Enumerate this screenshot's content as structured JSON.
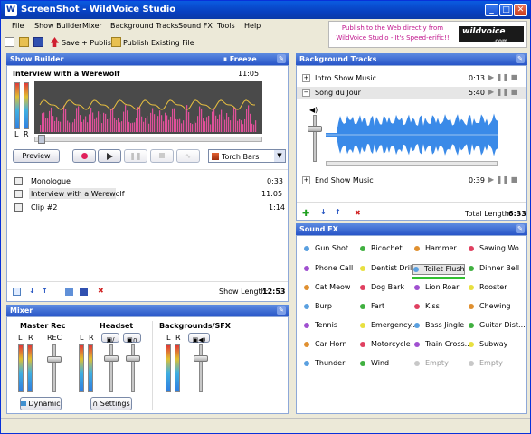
{
  "window": {
    "title": "ScreenShot - WildVoice Studio"
  },
  "menu": [
    "File",
    "Show Builder",
    "Mixer",
    "Background Tracks",
    "Sound FX",
    "Tools",
    "Help"
  ],
  "toolbar": {
    "save_publish": "Save + Publish",
    "publish_existing": "Publish Existing File"
  },
  "banner": {
    "line1": "Publish to the Web directly from",
    "line2": "WildVoice Studio - It's Speed-erific!!",
    "logo": "wildvoice",
    "logo_sub": ".com"
  },
  "show_builder": {
    "header": "Show Builder",
    "freeze": "Freeze",
    "current_title": "Interview with a Werewolf",
    "current_time": "11:05",
    "vu_l": "L",
    "vu_r": "R",
    "preview": "Preview",
    "effect": "Torch Bars",
    "items": [
      {
        "name": "Monologue",
        "time": "0:33"
      },
      {
        "name": "Interview with a Werewolf",
        "time": "11:05"
      },
      {
        "name": "Clip #2",
        "time": "1:14"
      }
    ],
    "length_label": "Show Length:",
    "length_value": "12:53"
  },
  "background_tracks": {
    "header": "Background Tracks",
    "tracks": [
      {
        "expander": "+",
        "name": "Intro Show Music",
        "time": "0:13"
      },
      {
        "expander": "−",
        "name": "Song du Jour",
        "time": "5:40"
      },
      {
        "expander": "+",
        "name": "End Show Music",
        "time": "0:39"
      }
    ],
    "total_label": "Total Length:",
    "total_value": "6:33"
  },
  "mixer": {
    "header": "Mixer",
    "master": "Master Rec",
    "headset": "Headset",
    "backgrounds": "Backgrounds/SFX",
    "rec": "REC",
    "l": "L",
    "r": "R",
    "dynamic": "Dynamic",
    "settings": "Settings"
  },
  "sound_fx": {
    "header": "Sound FX",
    "items": [
      {
        "label": "Gun Shot",
        "color": "#5aa0e0"
      },
      {
        "label": "Ricochet",
        "color": "#40b040"
      },
      {
        "label": "Hammer",
        "color": "#e09030"
      },
      {
        "label": "Sawing Wo...",
        "color": "#e04060"
      },
      {
        "label": "Phone Call",
        "color": "#a050d0"
      },
      {
        "label": "Dentist Drill",
        "color": "#e8e040"
      },
      {
        "label": "Toilet Flush",
        "color": "#5aa0e0"
      },
      {
        "label": "Dinner Bell",
        "color": "#40b040"
      },
      {
        "label": "Cat Meow",
        "color": "#e09030"
      },
      {
        "label": "Dog Bark",
        "color": "#e04060"
      },
      {
        "label": "Lion Roar",
        "color": "#a050d0"
      },
      {
        "label": "Rooster",
        "color": "#e8e040"
      },
      {
        "label": "Burp",
        "color": "#5aa0e0"
      },
      {
        "label": "Fart",
        "color": "#40b040"
      },
      {
        "label": "Kiss",
        "color": "#e04060"
      },
      {
        "label": "Chewing",
        "color": "#e09030"
      },
      {
        "label": "Tennis",
        "color": "#a050d0"
      },
      {
        "label": "Emergency...",
        "color": "#e8e040"
      },
      {
        "label": "Bass Jingle",
        "color": "#5aa0e0"
      },
      {
        "label": "Guitar Dist...",
        "color": "#40b040"
      },
      {
        "label": "Car Horn",
        "color": "#e09030"
      },
      {
        "label": "Motorcycle",
        "color": "#e04060"
      },
      {
        "label": "Train Cross...",
        "color": "#a050d0"
      },
      {
        "label": "Subway",
        "color": "#e8e040"
      },
      {
        "label": "Thunder",
        "color": "#5aa0e0"
      },
      {
        "label": "Wind",
        "color": "#40b040"
      },
      {
        "label": "Empty",
        "color": "#c8c8c8"
      },
      {
        "label": "Empty",
        "color": "#c8c8c8"
      }
    ]
  },
  "window_buttons": {
    "minimize": "_",
    "maximize": "□",
    "close": "✕"
  },
  "colors": {
    "title_bar": "#0a5be0",
    "panel_header": "#2855c8",
    "waveform_bg": "#4a4a4a",
    "background_wave": "#3a8ae8"
  }
}
